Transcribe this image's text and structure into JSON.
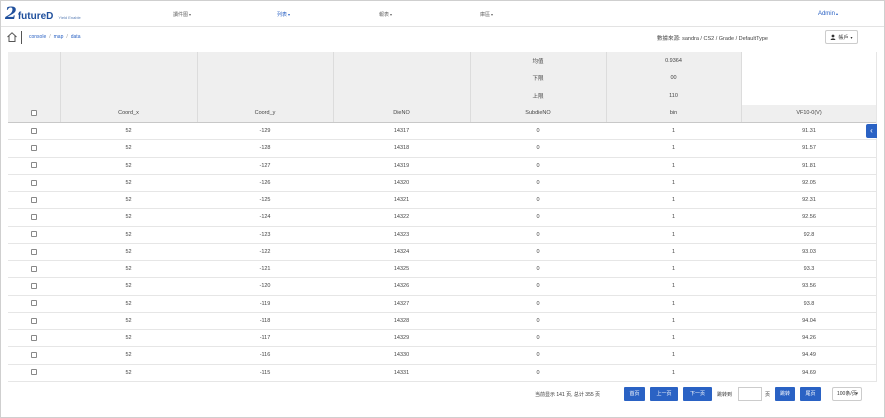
{
  "nav": {
    "logo_mark": "2",
    "logo_text": "futureD",
    "logo_sub": "Yield Enable",
    "items": [
      "讀件图",
      "列表",
      "報表",
      "庫區"
    ],
    "active_index": 1,
    "admin": "Admin"
  },
  "crumbs": [
    "console",
    "map",
    "data"
  ],
  "data_source": "數據來源: sandra / CS2 / Grade / DefaultType",
  "user_button": "帳戶",
  "table": {
    "stats": [
      {
        "label": "均值",
        "value": "0.9364"
      },
      {
        "label": "下限",
        "value": "00"
      },
      {
        "label": "上限",
        "value": "110"
      }
    ],
    "headers": [
      "Coord_x",
      "Coord_y",
      "DieNO",
      "SubdieNO",
      "bin",
      "VF10-0(V)"
    ],
    "rows": [
      [
        "52",
        "-129",
        "14317",
        "0",
        "1",
        "91.31"
      ],
      [
        "52",
        "-128",
        "14318",
        "0",
        "1",
        "91.57"
      ],
      [
        "52",
        "-127",
        "14319",
        "0",
        "1",
        "91.81"
      ],
      [
        "52",
        "-126",
        "14320",
        "0",
        "1",
        "92.05"
      ],
      [
        "52",
        "-125",
        "14321",
        "0",
        "1",
        "92.31"
      ],
      [
        "52",
        "-124",
        "14322",
        "0",
        "1",
        "92.56"
      ],
      [
        "52",
        "-123",
        "14323",
        "0",
        "1",
        "92.8"
      ],
      [
        "52",
        "-122",
        "14324",
        "0",
        "1",
        "93.03"
      ],
      [
        "52",
        "-121",
        "14325",
        "0",
        "1",
        "93.3"
      ],
      [
        "52",
        "-120",
        "14326",
        "0",
        "1",
        "93.56"
      ],
      [
        "52",
        "-119",
        "14327",
        "0",
        "1",
        "93.8"
      ],
      [
        "52",
        "-118",
        "14328",
        "0",
        "1",
        "94.04"
      ],
      [
        "52",
        "-117",
        "14329",
        "0",
        "1",
        "94.26"
      ],
      [
        "52",
        "-116",
        "14330",
        "0",
        "1",
        "94.49"
      ],
      [
        "52",
        "-115",
        "14331",
        "0",
        "1",
        "94.69"
      ]
    ]
  },
  "pager": {
    "info": "当前显示 141 页, 总计 355 页",
    "first": "首页",
    "prev": "上一页",
    "next": "下一页",
    "goto_label": "跳转到",
    "page_unit": "页",
    "go": "跳转",
    "last": "尾页",
    "page_size": "100条/页"
  },
  "colors": {
    "accent": "#2a62c4",
    "header_bg": "#efefef"
  },
  "icons": {
    "home": "home-icon",
    "user": "user-icon",
    "side": "chevron-left-icon"
  }
}
